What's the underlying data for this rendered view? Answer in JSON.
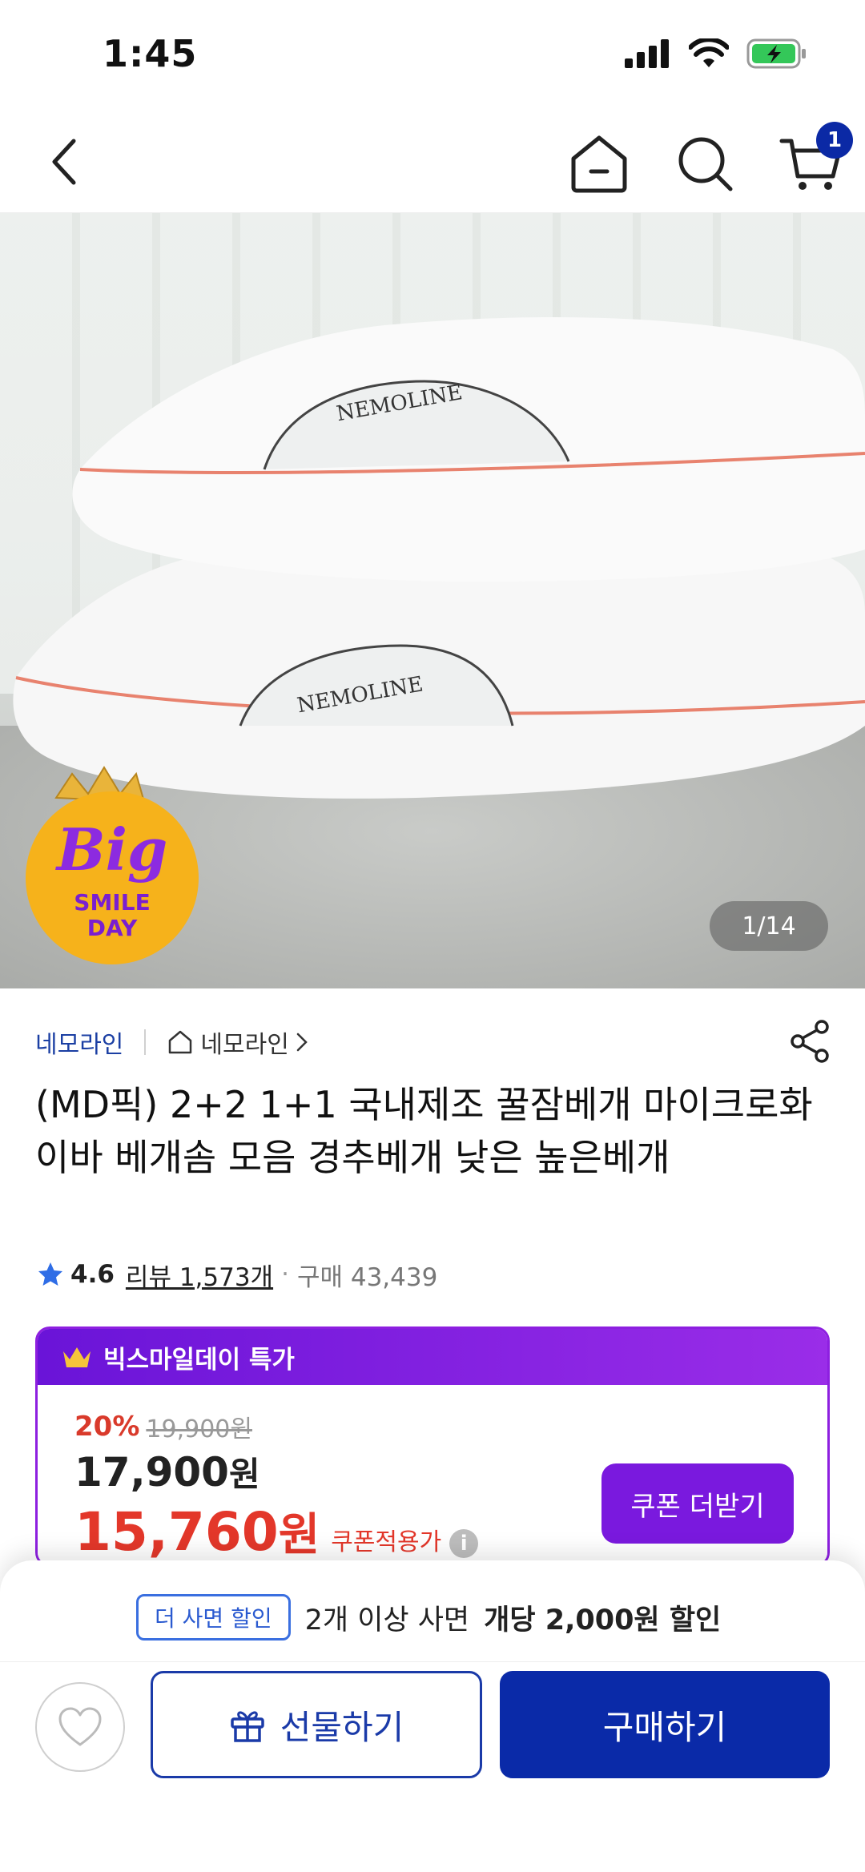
{
  "status": {
    "time": "1:45"
  },
  "nav": {
    "cart_count": "1"
  },
  "hero": {
    "brand_print": "NEMOLINE",
    "event_badge": {
      "line1": "Big",
      "line2": "SMILE",
      "line3": "DAY"
    },
    "slide_counter": "1/14"
  },
  "brand": {
    "name": "네모라인",
    "store": "네모라인"
  },
  "product": {
    "title": "(MD픽) 2+2 1+1 국내제조 꿀잠베개 마이크로화이바 베개솜 모음 경추베개 낮은 높은베개",
    "rating": "4.6",
    "review_label": "리뷰 1,573개",
    "purchase_label": "구매 43,439"
  },
  "deal": {
    "header": "빅스마일데이 특가",
    "discount_rate": "20%",
    "original_price": "19,900원",
    "sale_price_num": "17,900",
    "sale_price_unit": "원",
    "coupon_price_num": "15,760",
    "coupon_price_unit": "원",
    "coupon_label": "쿠폰적용가",
    "coupon_button": "쿠폰 더받기"
  },
  "bottom": {
    "promo_badge": "더 사면 할인",
    "promo_text": "2개 이상 사면",
    "promo_strong": "개당 2,000원 할인",
    "gift_button": "선물하기",
    "buy_button": "구매하기"
  },
  "colors": {
    "primary_blue": "#0a2aa8",
    "deal_purple": "#7a19de",
    "price_red": "#e3372a"
  }
}
